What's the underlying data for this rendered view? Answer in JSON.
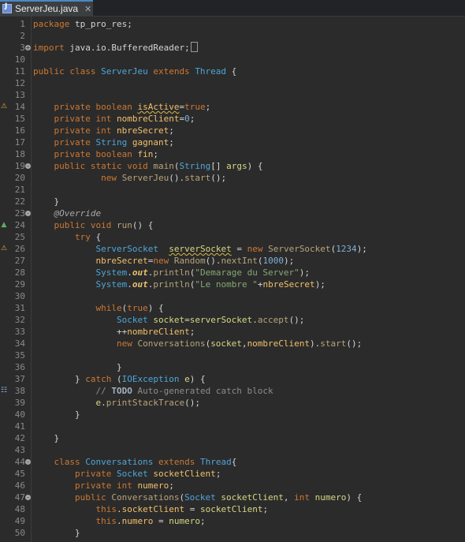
{
  "tab": {
    "title": "ServerJeu.java",
    "close_glyph": "✕"
  },
  "gutter_markers": {
    "warning": "⚠",
    "override": "▲",
    "task": "☷"
  },
  "lines": [
    {
      "n": "1",
      "segs": [
        [
          "kw",
          "package"
        ],
        [
          "pl",
          " tp_pro_res;"
        ]
      ]
    },
    {
      "n": "2",
      "segs": []
    },
    {
      "n": "3",
      "fold": "+",
      "segs": [
        [
          "kw",
          "import"
        ],
        [
          "pl",
          " java.io.BufferedReader;"
        ]
      ],
      "foldbox": true
    },
    {
      "n": "10",
      "segs": []
    },
    {
      "n": "11",
      "segs": [
        [
          "kw",
          "public class "
        ],
        [
          "ty",
          "ServerJeu"
        ],
        [
          "kw",
          " extends "
        ],
        [
          "ty",
          "Thread"
        ],
        [
          "pl",
          " {"
        ]
      ]
    },
    {
      "n": "12",
      "segs": []
    },
    {
      "n": "13",
      "segs": []
    },
    {
      "n": "14",
      "marker": "warning",
      "segs": [
        [
          "pl",
          "    "
        ],
        [
          "kw",
          "private boolean "
        ],
        [
          "fld warn",
          "isActive"
        ],
        [
          "pl",
          "="
        ],
        [
          "kw",
          "true"
        ],
        [
          "pl",
          ";"
        ]
      ]
    },
    {
      "n": "15",
      "segs": [
        [
          "pl",
          "    "
        ],
        [
          "kw",
          "private int "
        ],
        [
          "fld",
          "nombreClient"
        ],
        [
          "pl",
          "="
        ],
        [
          "nm",
          "0"
        ],
        [
          "pl",
          ";"
        ]
      ]
    },
    {
      "n": "16",
      "segs": [
        [
          "pl",
          "    "
        ],
        [
          "kw",
          "private int "
        ],
        [
          "fld",
          "nbreSecret"
        ],
        [
          "pl",
          ";"
        ]
      ]
    },
    {
      "n": "17",
      "segs": [
        [
          "pl",
          "    "
        ],
        [
          "kw",
          "private "
        ],
        [
          "ty",
          "String "
        ],
        [
          "fld",
          "gagnant"
        ],
        [
          "pl",
          ";"
        ]
      ]
    },
    {
      "n": "18",
      "segs": [
        [
          "pl",
          "    "
        ],
        [
          "kw",
          "private boolean "
        ],
        [
          "fld",
          "fin"
        ],
        [
          "pl",
          ";"
        ]
      ]
    },
    {
      "n": "19",
      "fold": "-",
      "segs": [
        [
          "pl",
          "    "
        ],
        [
          "kw",
          "public static void "
        ],
        [
          "cls",
          "main"
        ],
        [
          "pl",
          "("
        ],
        [
          "ty",
          "String"
        ],
        [
          "pl",
          "[] "
        ],
        [
          "vr",
          "args"
        ],
        [
          "pl",
          ") {"
        ]
      ]
    },
    {
      "n": "20",
      "segs": [
        [
          "pl",
          "             "
        ],
        [
          "kw",
          "new "
        ],
        [
          "cls",
          "ServerJeu"
        ],
        [
          "pl",
          "()."
        ],
        [
          "cls",
          "start"
        ],
        [
          "pl",
          "();"
        ]
      ]
    },
    {
      "n": "21",
      "segs": []
    },
    {
      "n": "22",
      "segs": [
        [
          "pl",
          "    }"
        ]
      ]
    },
    {
      "n": "23",
      "fold": "-",
      "segs": [
        [
          "pl",
          "    "
        ],
        [
          "ann",
          "@Override"
        ]
      ]
    },
    {
      "n": "24",
      "marker": "override",
      "segs": [
        [
          "pl",
          "    "
        ],
        [
          "kw",
          "public void "
        ],
        [
          "cls",
          "run"
        ],
        [
          "pl",
          "() {"
        ]
      ]
    },
    {
      "n": "25",
      "segs": [
        [
          "pl",
          "        "
        ],
        [
          "kw",
          "try"
        ],
        [
          "pl",
          " {"
        ]
      ]
    },
    {
      "n": "26",
      "marker": "warning",
      "segs": [
        [
          "pl",
          "            "
        ],
        [
          "ty",
          "ServerSocket"
        ],
        [
          "pl",
          "  "
        ],
        [
          "vr warn",
          "serverSocket"
        ],
        [
          "pl",
          " = "
        ],
        [
          "kw",
          "new "
        ],
        [
          "cls",
          "ServerSocket"
        ],
        [
          "pl",
          "("
        ],
        [
          "nm",
          "1234"
        ],
        [
          "pl",
          ");"
        ]
      ]
    },
    {
      "n": "27",
      "segs": [
        [
          "pl",
          "            "
        ],
        [
          "fld",
          "nbreSecret"
        ],
        [
          "pl",
          "="
        ],
        [
          "kw",
          "new "
        ],
        [
          "cls",
          "Random"
        ],
        [
          "pl",
          "()."
        ],
        [
          "cls",
          "nextInt"
        ],
        [
          "pl",
          "("
        ],
        [
          "nm",
          "1000"
        ],
        [
          "pl",
          ");"
        ]
      ]
    },
    {
      "n": "28",
      "segs": [
        [
          "pl",
          "            "
        ],
        [
          "ty",
          "System"
        ],
        [
          "pl",
          "."
        ],
        [
          "stf",
          "out"
        ],
        [
          "pl",
          "."
        ],
        [
          "cls",
          "println"
        ],
        [
          "pl",
          "("
        ],
        [
          "st",
          "\"Demarage du Server\""
        ],
        [
          "pl",
          ");"
        ]
      ]
    },
    {
      "n": "29",
      "segs": [
        [
          "pl",
          "            "
        ],
        [
          "ty",
          "System"
        ],
        [
          "pl",
          "."
        ],
        [
          "stf",
          "out"
        ],
        [
          "pl",
          "."
        ],
        [
          "cls",
          "println"
        ],
        [
          "pl",
          "("
        ],
        [
          "st",
          "\"Le nombre \""
        ],
        [
          "pl",
          "+"
        ],
        [
          "fld",
          "nbreSecret"
        ],
        [
          "pl",
          ");"
        ]
      ]
    },
    {
      "n": "30",
      "segs": []
    },
    {
      "n": "31",
      "segs": [
        [
          "pl",
          "            "
        ],
        [
          "kw",
          "while"
        ],
        [
          "pl",
          "("
        ],
        [
          "kw",
          "true"
        ],
        [
          "pl",
          ") {"
        ]
      ]
    },
    {
      "n": "32",
      "segs": [
        [
          "pl",
          "                "
        ],
        [
          "ty",
          "Socket "
        ],
        [
          "vr",
          "socket"
        ],
        [
          "pl",
          "="
        ],
        [
          "vr",
          "serverSocket"
        ],
        [
          "pl",
          "."
        ],
        [
          "cls",
          "accept"
        ],
        [
          "pl",
          "();"
        ]
      ]
    },
    {
      "n": "33",
      "segs": [
        [
          "pl",
          "                ++"
        ],
        [
          "fld",
          "nombreClient"
        ],
        [
          "pl",
          ";"
        ]
      ]
    },
    {
      "n": "34",
      "segs": [
        [
          "pl",
          "                "
        ],
        [
          "kw",
          "new "
        ],
        [
          "cls",
          "Conversations"
        ],
        [
          "pl",
          "("
        ],
        [
          "vr",
          "socket"
        ],
        [
          "pl",
          ","
        ],
        [
          "fld",
          "nombreClient"
        ],
        [
          "pl",
          ")."
        ],
        [
          "cls",
          "start"
        ],
        [
          "pl",
          "();"
        ]
      ]
    },
    {
      "n": "35",
      "segs": []
    },
    {
      "n": "36",
      "segs": [
        [
          "pl",
          "                }"
        ]
      ]
    },
    {
      "n": "37",
      "segs": [
        [
          "pl",
          "        } "
        ],
        [
          "kw",
          "catch"
        ],
        [
          "pl",
          " ("
        ],
        [
          "ty",
          "IOException "
        ],
        [
          "vr",
          "e"
        ],
        [
          "pl",
          ") {"
        ]
      ]
    },
    {
      "n": "38",
      "marker": "task",
      "segs": [
        [
          "pl",
          "            "
        ],
        [
          "cm",
          "// "
        ],
        [
          "todo",
          "TODO"
        ],
        [
          "cm",
          " Auto-generated catch block"
        ]
      ]
    },
    {
      "n": "39",
      "segs": [
        [
          "pl",
          "            "
        ],
        [
          "vr",
          "e"
        ],
        [
          "pl",
          "."
        ],
        [
          "cls",
          "printStackTrace"
        ],
        [
          "pl",
          "();"
        ]
      ]
    },
    {
      "n": "40",
      "segs": [
        [
          "pl",
          "        }"
        ]
      ]
    },
    {
      "n": "41",
      "segs": []
    },
    {
      "n": "42",
      "segs": [
        [
          "pl",
          "    }"
        ]
      ]
    },
    {
      "n": "43",
      "segs": []
    },
    {
      "n": "44",
      "fold": "-",
      "segs": [
        [
          "pl",
          "    "
        ],
        [
          "kw",
          "class "
        ],
        [
          "ty",
          "Conversations"
        ],
        [
          "kw",
          " extends "
        ],
        [
          "ty",
          "Thread"
        ],
        [
          "pl",
          "{"
        ]
      ]
    },
    {
      "n": "45",
      "segs": [
        [
          "pl",
          "        "
        ],
        [
          "kw",
          "private "
        ],
        [
          "ty",
          "Socket "
        ],
        [
          "fld",
          "socketClient"
        ],
        [
          "pl",
          ";"
        ]
      ]
    },
    {
      "n": "46",
      "segs": [
        [
          "pl",
          "        "
        ],
        [
          "kw",
          "private int "
        ],
        [
          "fld",
          "numero"
        ],
        [
          "pl",
          ";"
        ]
      ]
    },
    {
      "n": "47",
      "fold": "-",
      "segs": [
        [
          "pl",
          "        "
        ],
        [
          "kw",
          "public "
        ],
        [
          "cls",
          "Conversations"
        ],
        [
          "pl",
          "("
        ],
        [
          "ty",
          "Socket "
        ],
        [
          "vr",
          "socketClient"
        ],
        [
          "pl",
          ", "
        ],
        [
          "kw",
          "int "
        ],
        [
          "vr",
          "numero"
        ],
        [
          "pl",
          ") {"
        ]
      ]
    },
    {
      "n": "48",
      "segs": [
        [
          "pl",
          "            "
        ],
        [
          "kw",
          "this"
        ],
        [
          "pl",
          "."
        ],
        [
          "fld",
          "socketClient"
        ],
        [
          "pl",
          " = "
        ],
        [
          "vr",
          "socketClient"
        ],
        [
          "pl",
          ";"
        ]
      ]
    },
    {
      "n": "49",
      "segs": [
        [
          "pl",
          "            "
        ],
        [
          "kw",
          "this"
        ],
        [
          "pl",
          "."
        ],
        [
          "fld",
          "numero"
        ],
        [
          "pl",
          " = "
        ],
        [
          "vr",
          "numero"
        ],
        [
          "pl",
          ";"
        ]
      ]
    },
    {
      "n": "50",
      "segs": [
        [
          "pl",
          "        }"
        ]
      ]
    }
  ]
}
